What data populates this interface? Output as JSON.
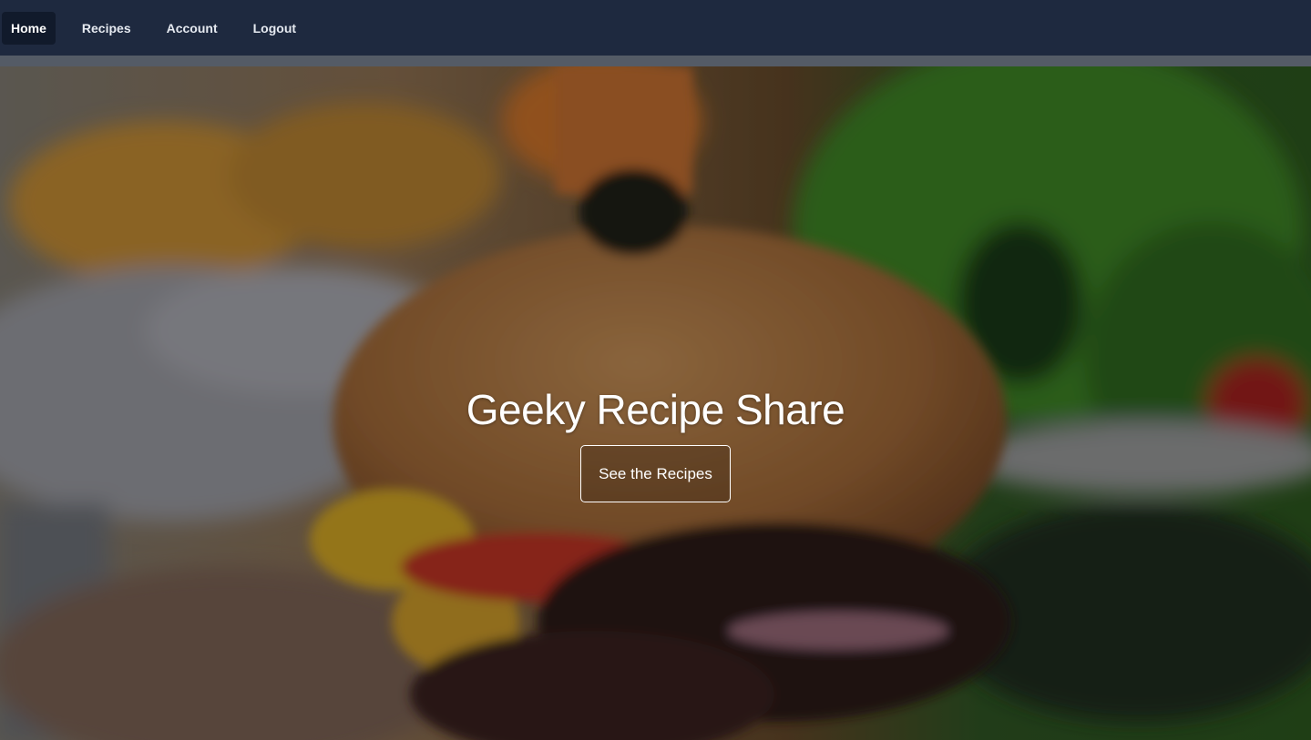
{
  "navbar": {
    "items": [
      {
        "label": "Home",
        "active": true
      },
      {
        "label": "Recipes",
        "active": false
      },
      {
        "label": "Account",
        "active": false
      },
      {
        "label": "Logout",
        "active": false
      }
    ]
  },
  "hero": {
    "title": "Geeky Recipe Share",
    "button_label": "See the Recipes",
    "image": "blurred burger with fries and salad background"
  },
  "colors": {
    "navbar_bg": "#1e293f",
    "active_item_bg": "#111a2b",
    "divider": "#545b66",
    "text": "#ffffff"
  }
}
